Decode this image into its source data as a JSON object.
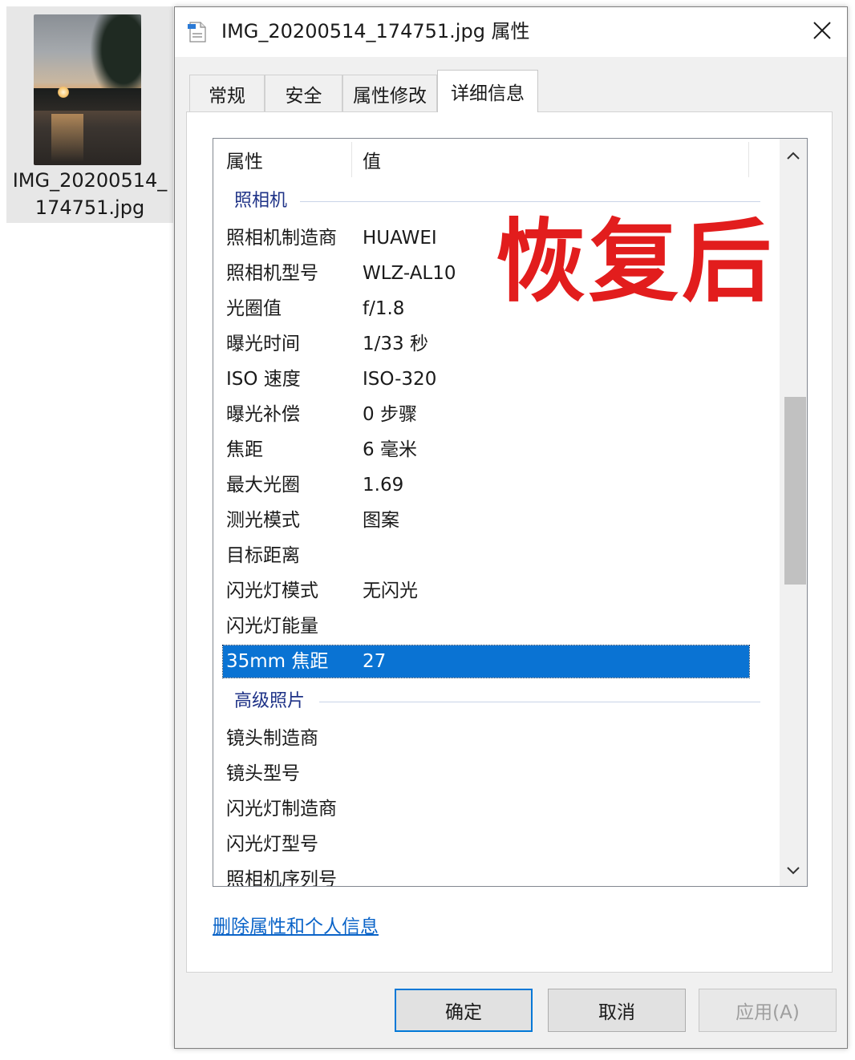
{
  "file": {
    "name_line1": "IMG_20200514_",
    "name_line2": "174751.jpg"
  },
  "dialog": {
    "title": "IMG_20200514_174751.jpg 属性",
    "tabs": [
      {
        "label": "常规"
      },
      {
        "label": "安全"
      },
      {
        "label": "属性修改"
      },
      {
        "label": "详细信息"
      }
    ],
    "active_tab": "详细信息",
    "columns": {
      "property": "属性",
      "value": "值"
    },
    "groups": [
      {
        "label": "照相机",
        "rows": [
          {
            "key": "照相机制造商",
            "value": "HUAWEI"
          },
          {
            "key": "照相机型号",
            "value": "WLZ-AL10"
          },
          {
            "key": "光圈值",
            "value": "f/1.8"
          },
          {
            "key": "曝光时间",
            "value": "1/33 秒"
          },
          {
            "key": "ISO 速度",
            "value": "ISO-320"
          },
          {
            "key": "曝光补偿",
            "value": "0 步骤"
          },
          {
            "key": "焦距",
            "value": "6 毫米"
          },
          {
            "key": "最大光圈",
            "value": "1.69"
          },
          {
            "key": "测光模式",
            "value": "图案"
          },
          {
            "key": "目标距离",
            "value": ""
          },
          {
            "key": "闪光灯模式",
            "value": "无闪光"
          },
          {
            "key": "闪光灯能量",
            "value": ""
          },
          {
            "key": "35mm 焦距",
            "value": "27"
          }
        ]
      },
      {
        "label": "高级照片",
        "rows": [
          {
            "key": "镜头制造商",
            "value": ""
          },
          {
            "key": "镜头型号",
            "value": ""
          },
          {
            "key": "闪光灯制造商",
            "value": ""
          },
          {
            "key": "闪光灯型号",
            "value": ""
          },
          {
            "key": "照相机序列号",
            "value": ""
          }
        ]
      }
    ],
    "remove_link": "删除属性和个人信息",
    "buttons": {
      "ok": "确定",
      "cancel": "取消",
      "apply": "应用(A)"
    }
  },
  "overlay_text": "恢复后",
  "colors": {
    "selection": "#0a73d3",
    "group_label": "#1e3287",
    "link": "#0b64c8",
    "overlay": "#e21d1d",
    "default_button_border": "#0078d7"
  },
  "icons": [
    "document-properties-icon",
    "close-icon",
    "scroll-up-icon",
    "scroll-down-icon"
  ]
}
